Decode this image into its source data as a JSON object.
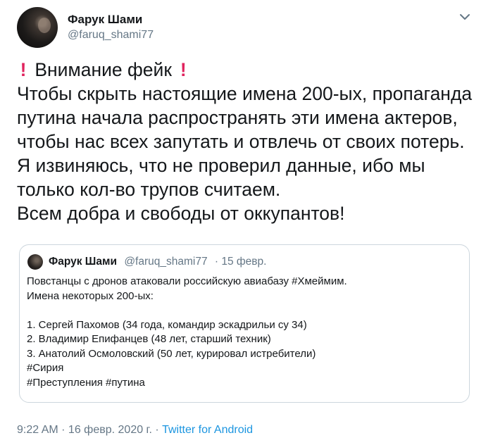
{
  "author": {
    "name": "Фарук Шами",
    "handle": "@faruq_shami77"
  },
  "tweet": {
    "warning": "Внимание фейк",
    "text": "Чтобы скрыть настоящие имена 200-ых, пропаганда\nпутина начала распространять эти имена актеров,\nчтобы нас всех запутать и отвлечь от своих потерь.\nЯ извиняюсь, что не проверил данные, ибо мы\nтолько кол-во трупов считаем.\nВсем добра и свободы от оккупантов!"
  },
  "quoted_tweet": {
    "name": "Фарук Шами",
    "handle": "@faruq_shami77",
    "date": "· 15 февр.",
    "text": "Повстанцы с дронов атаковали российскую авиабазу #Хмеймим.\nИмена некоторых 200-ых:\n\n1. Сергей Пахомов (34 года, командир эскадрильи су 34)\n2. Владимир Епифанцев (48 лет, старший техник)\n3. Анатолий Осмоловский (50 лет, курировал истребители)\n#Сирия\n#Преступления #путина"
  },
  "footer": {
    "timestamp": "9:22 AM · 16 февр. 2020 г. · ",
    "source": "Twitter for Android"
  },
  "icons": {
    "warning": "exclamation-icon",
    "menu": "chevron-down-icon"
  },
  "colors": {
    "accent": "#1b95e0",
    "secondary_text": "#657786",
    "border": "#ccd6dd",
    "exclamation": "#e0245e"
  }
}
